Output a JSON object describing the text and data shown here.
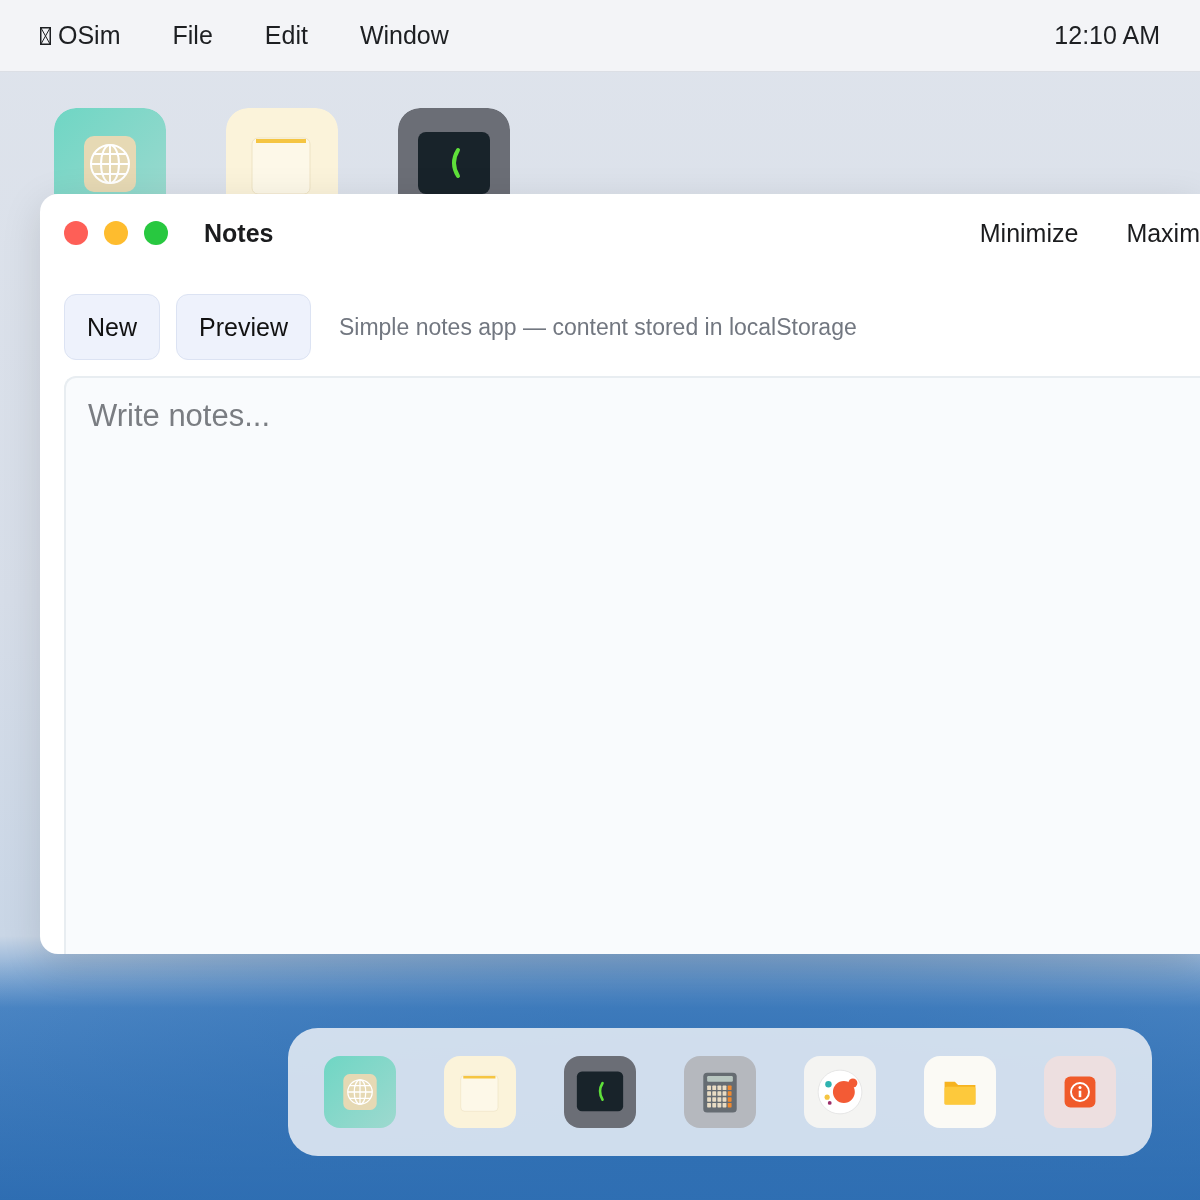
{
  "menu_bar": {
    "items": [
      {
        "label": "OSim",
        "kind": "glyph-box"
      },
      {
        "label": "File",
        "kind": "text"
      },
      {
        "label": "Edit",
        "kind": "text"
      },
      {
        "label": "Window",
        "kind": "text"
      }
    ],
    "clock": "12:10 AM"
  },
  "desktop_icons": [
    {
      "kind": "globe"
    },
    {
      "kind": "notes"
    },
    {
      "kind": "terminal"
    }
  ],
  "window": {
    "title": "Notes",
    "controls": [
      "Minimize",
      "Maxim"
    ],
    "toolbar": {
      "buttons": [
        "New",
        "Preview"
      ],
      "note": "Simple notes app — content stored in localStorage"
    },
    "editor": {
      "placeholder": "Write notes..."
    }
  },
  "dock": [
    {
      "kind": "globe"
    },
    {
      "kind": "notes"
    },
    {
      "kind": "terminal"
    },
    {
      "kind": "calculator"
    },
    {
      "kind": "paint"
    },
    {
      "kind": "folder"
    },
    {
      "kind": "info"
    }
  ]
}
